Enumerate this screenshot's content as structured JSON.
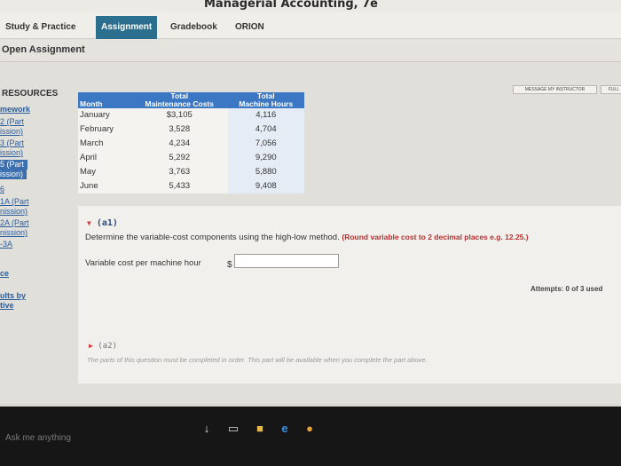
{
  "app": {
    "title": "Managerial Accounting, 7e"
  },
  "nav": {
    "items": [
      {
        "label": "Study & Practice"
      },
      {
        "label": "Assignment"
      },
      {
        "label": "Gradebook"
      },
      {
        "label": "ORION"
      }
    ]
  },
  "header": {
    "open_title": "Open Assignment",
    "message_instructor": "MESSAGE MY INSTRUCTOR",
    "full": "FULL"
  },
  "sidebar": {
    "title": "RESOURCES",
    "links": [
      "mework",
      "2 (Part",
      "ission)",
      "3 (Part",
      "ission)",
      "5 (Part",
      "ission)",
      "6",
      "1A (Part",
      "nission)",
      "2A (Part",
      "nission)",
      "-3A",
      "ce",
      "ults by",
      "tive"
    ]
  },
  "table": {
    "headers": {
      "month": "Month",
      "cost_top": "Total",
      "cost_bottom": "Maintenance Costs",
      "hours_top": "Total",
      "hours_bottom": "Machine Hours"
    },
    "rows": [
      {
        "month": "January",
        "cost": "$3,105",
        "hours": "4,116"
      },
      {
        "month": "February",
        "cost": "3,528",
        "hours": "4,704"
      },
      {
        "month": "March",
        "cost": "4,234",
        "hours": "7,056"
      },
      {
        "month": "April",
        "cost": "5,292",
        "hours": "9,290"
      },
      {
        "month": "May",
        "cost": "3,763",
        "hours": "5,880"
      },
      {
        "month": "June",
        "cost": "5,433",
        "hours": "9,408"
      }
    ]
  },
  "question": {
    "a1_label": "(a1)",
    "instruction": "Determine the variable-cost components using the high-low method.",
    "instruction_note": "(Round variable cost to 2 decimal places e.g. 12.25.)",
    "variable_cost_label": "Variable cost per machine hour",
    "currency": "$",
    "input_value": "",
    "attempts": "Attempts: 0 of 3 used",
    "a2_label": "(a2)",
    "a2_note": "The parts of this question must be completed in order. This part will be available when you complete the part above."
  },
  "taskbar": {
    "search_placeholder": "Ask me anything"
  }
}
